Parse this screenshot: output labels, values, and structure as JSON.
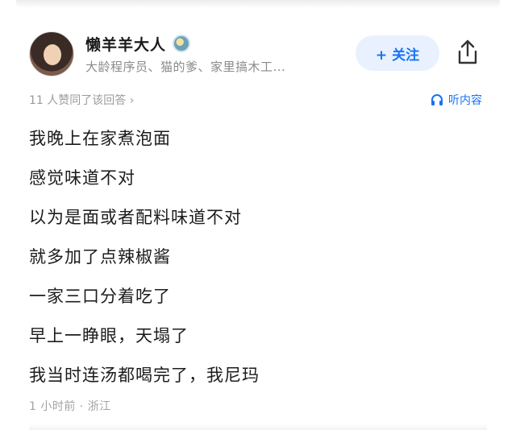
{
  "author": {
    "name": "懒羊羊大人",
    "bio": "大龄程序员、猫的爹、家里搞木工..."
  },
  "follow_label": "+ 关注",
  "approve_text": "11 人赞同了该回答 ›",
  "listen_label": "听内容",
  "content_lines": [
    "我晚上在家煮泡面",
    "感觉味道不对",
    "以为是面或者配料味道不对",
    "就多加了点辣椒酱",
    "一家三口分着吃了",
    "早上一睁眼，天塌了",
    "我当时连汤都喝完了，我尼玛"
  ],
  "footer_text": "1 小时前 · 浙江",
  "colors": {
    "accent": "#1772f6",
    "follow_bg": "#e8f1fd",
    "muted": "#9a9a9a"
  },
  "icons": [
    "avatar",
    "user-badge-icon",
    "share-icon",
    "headphones-icon"
  ]
}
